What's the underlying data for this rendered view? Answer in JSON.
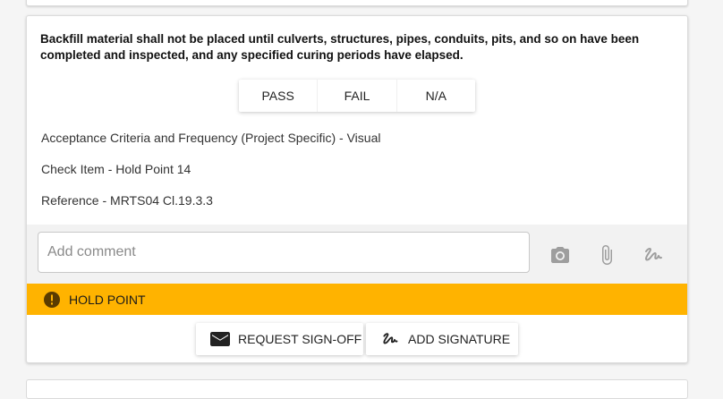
{
  "question": "Backfill material shall not be placed until culverts, structures, pipes, conduits, pits, and so on have been completed and inspected, and any specified curing periods have elapsed.",
  "choices": [
    "PASS",
    "FAIL",
    "N/A"
  ],
  "info": {
    "acceptance": "Acceptance Criteria and Frequency (Project Specific) - Visual",
    "check_item": "Check Item - Hold Point 14",
    "reference": "Reference - MRTS04 Cl.19.3.3"
  },
  "comment": {
    "placeholder": "Add comment",
    "value": ""
  },
  "tools": [
    "camera-icon",
    "attachment-icon",
    "signature-icon"
  ],
  "hold_point": {
    "label": "HOLD POINT",
    "color": "#ffb300"
  },
  "actions": {
    "request_signoff": "REQUEST SIGN-OFF",
    "add_signature": "ADD SIGNATURE"
  }
}
